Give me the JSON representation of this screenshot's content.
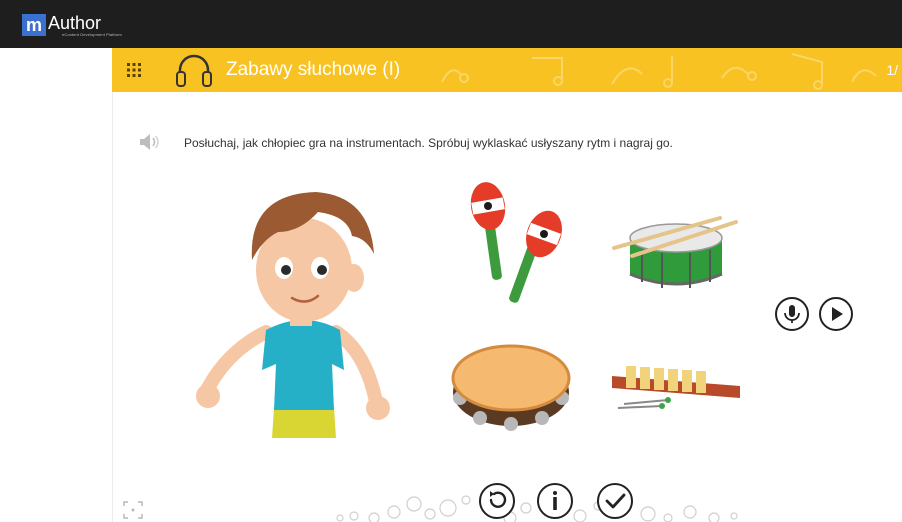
{
  "app": {
    "logo_letter": "m",
    "logo_name": "Author",
    "logo_tagline": "eContent Development Platform"
  },
  "header": {
    "title": "Zabawy słuchowe (I)",
    "page_indicator": "1/",
    "background_color": "#f8c223",
    "icons": [
      "grid-menu-icon",
      "headphones-icon"
    ]
  },
  "content": {
    "instruction": "Posłuchaj, jak chłopiec gra na instrumentach. Spróbuj wyklaskać usłyszany rytm i nagraj go.",
    "images": [
      "boy",
      "maracas",
      "drum",
      "tambourine",
      "xylophone"
    ]
  },
  "recorder": {
    "icons": [
      "microphone-icon",
      "play-icon"
    ]
  },
  "controls": {
    "icons": [
      "reset-icon",
      "info-icon",
      "check-icon",
      "fullscreen-icon"
    ]
  }
}
